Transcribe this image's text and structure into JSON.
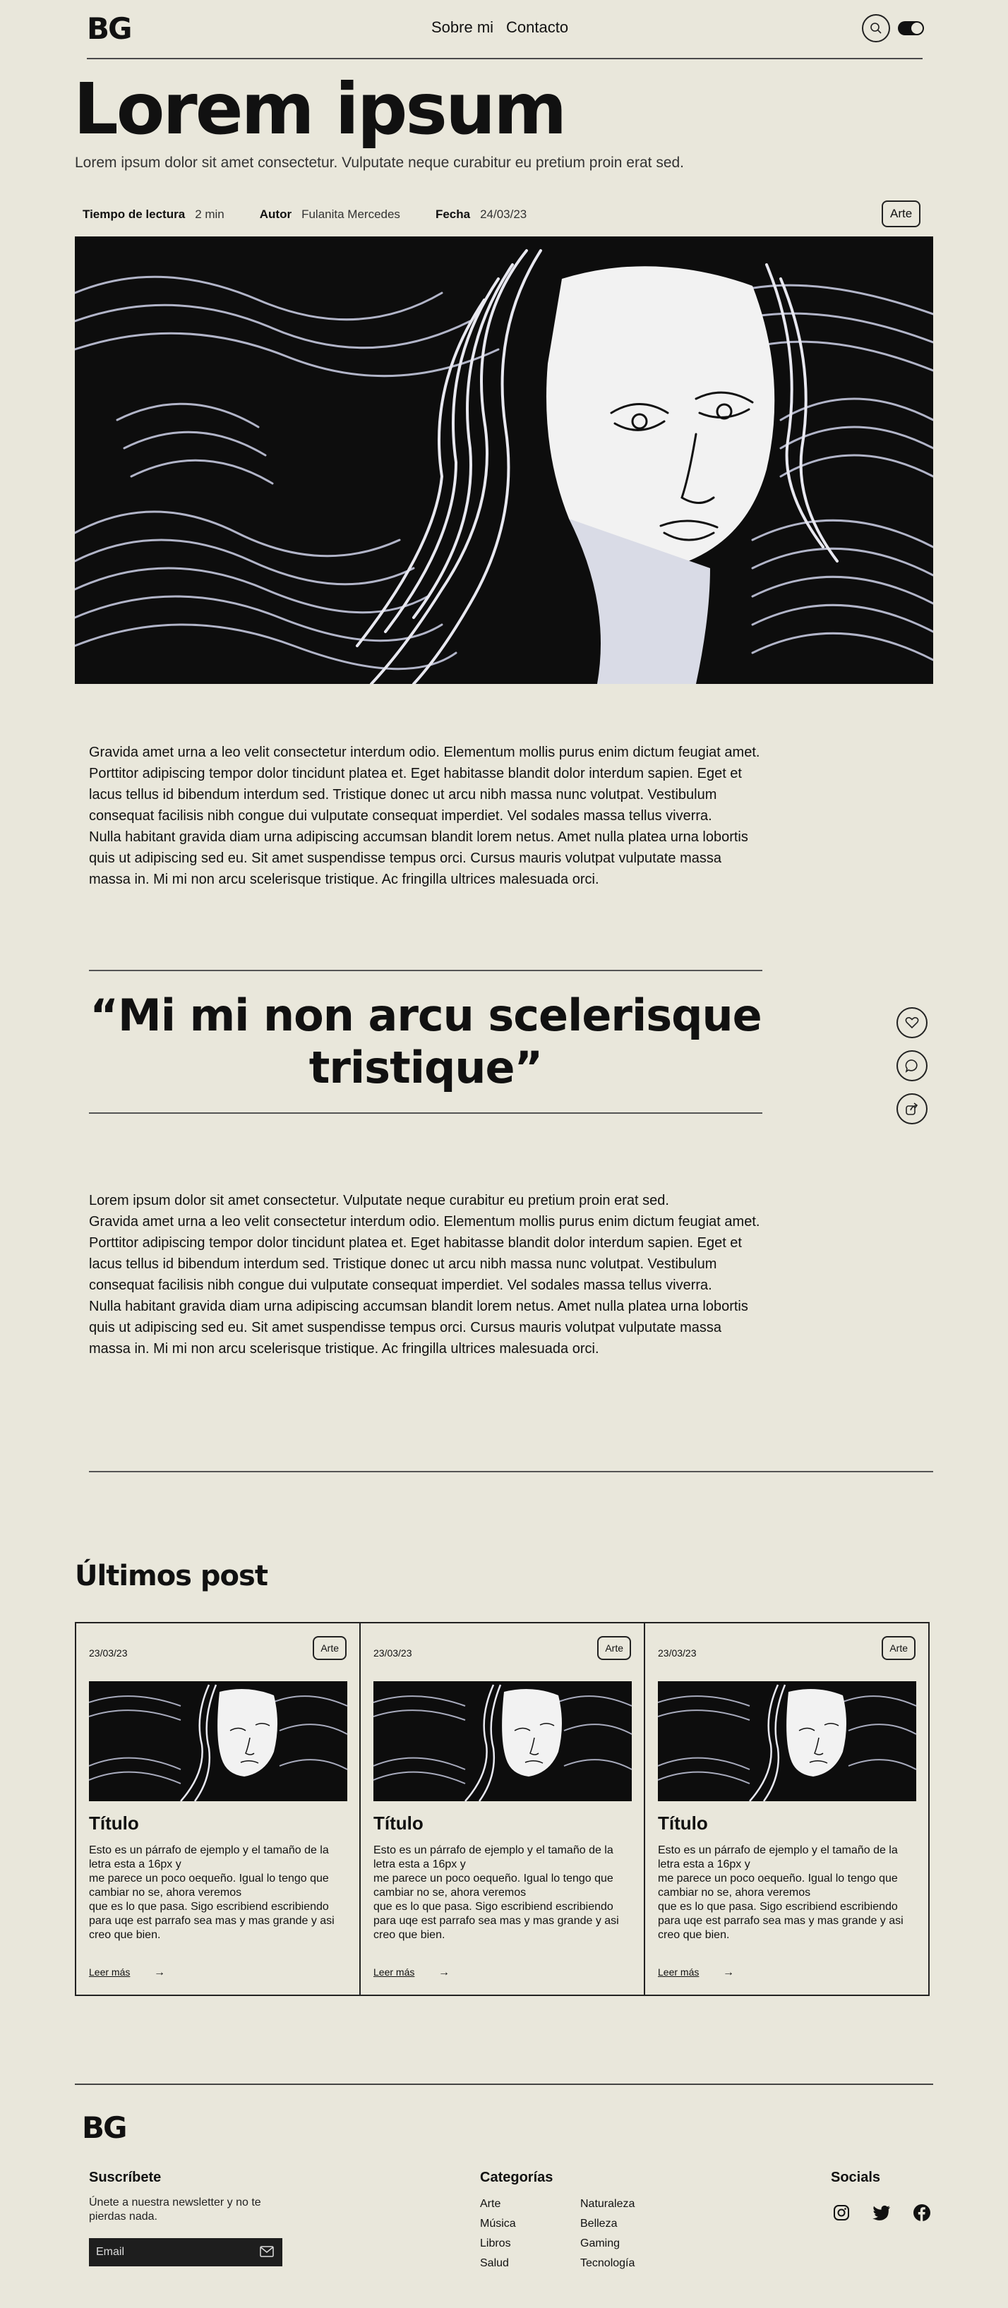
{
  "header": {
    "logo": "BG",
    "nav": [
      "Sobre mi",
      "Contacto"
    ]
  },
  "article": {
    "title": "Lorem ipsum",
    "subtitle": "Lorem ipsum dolor sit amet consectetur. Vulputate neque curabitur eu pretium proin erat sed.",
    "meta": {
      "reading_label": "Tiempo de lectura",
      "reading_value": "2 min",
      "author_label": "Autor",
      "author_value": "Fulanita Mercedes",
      "date_label": "Fecha",
      "date_value": "24/03/23"
    },
    "tag": "Arte",
    "paragraphs_1": [
      "Gravida amet urna a leo velit consectetur interdum odio. Elementum mollis purus enim dictum feugiat amet. Porttitor adipiscing tempor dolor tincidunt platea et. Eget habitasse blandit dolor interdum sapien. Eget et lacus tellus id bibendum interdum sed. Tristique donec ut arcu nibh massa nunc volutpat. Vestibulum consequat facilisis nibh congue dui vulputate consequat imperdiet. Vel sodales massa tellus viverra.",
      "Nulla habitant gravida diam urna adipiscing accumsan blandit lorem netus. Amet nulla platea urna lobortis quis ut adipiscing sed eu. Sit amet suspendisse tempus orci. Cursus mauris volutpat vulputate massa massa in. Mi mi non arcu scelerisque tristique. Ac fringilla ultrices malesuada orci."
    ],
    "quote": "“Mi mi non arcu scelerisque tristique”",
    "paragraphs_2": [
      "Lorem ipsum dolor sit amet consectetur. Vulputate neque curabitur eu pretium proin erat sed.",
      "Gravida amet urna a leo velit consectetur interdum odio. Elementum mollis purus enim dictum feugiat amet. Porttitor adipiscing tempor dolor tincidunt platea et. Eget habitasse blandit dolor interdum sapien. Eget et lacus tellus id bibendum interdum sed. Tristique donec ut arcu nibh massa nunc volutpat. Vestibulum consequat facilisis nibh congue dui vulputate consequat imperdiet. Vel sodales massa tellus viverra.",
      "Nulla habitant gravida diam urna adipiscing accumsan blandit lorem netus. Amet nulla platea urna lobortis quis ut adipiscing sed eu. Sit amet suspendisse tempus orci. Cursus mauris volutpat vulputate massa massa in. Mi mi non arcu scelerisque tristique. Ac fringilla ultrices malesuada orci."
    ],
    "actions": [
      "heart-icon",
      "comment-icon",
      "share-icon"
    ]
  },
  "latest": {
    "heading": "Últimos post",
    "cards": [
      {
        "date": "23/03/23",
        "tag": "Arte",
        "title": "Título",
        "text": "Esto es un párrafo de ejemplo y el tamaño de la letra esta a 16px y\nme parece un poco oequeño. Igual lo tengo que cambiar no se, ahora veremos\nque es lo que pasa. Sigo escribiend escribiendo para uqe est parrafo sea mas y mas grande y asi creo que bien.",
        "more": "Leer más"
      },
      {
        "date": "23/03/23",
        "tag": "Arte",
        "title": "Título",
        "text": "Esto es un párrafo de ejemplo y el tamaño de la letra esta a 16px y\nme parece un poco oequeño. Igual lo tengo que cambiar no se, ahora veremos\nque es lo que pasa. Sigo escribiend escribiendo para uqe est parrafo sea mas y mas grande y asi creo que bien.",
        "more": "Leer más"
      },
      {
        "date": "23/03/23",
        "tag": "Arte",
        "title": "Título",
        "text": "Esto es un párrafo de ejemplo y el tamaño de la letra esta a 16px y\nme parece un poco oequeño. Igual lo tengo que cambiar no se, ahora veremos\nque es lo que pasa. Sigo escribiend escribiendo para uqe est parrafo sea mas y mas grande y asi creo que bien.",
        "more": "Leer más"
      }
    ]
  },
  "footer": {
    "logo": "BG",
    "newsletter_heading": "Suscríbete",
    "newsletter_text": "Únete a nuestra newsletter y no te pierdas nada.",
    "email_placeholder": "Email",
    "categories_heading": "Categorías",
    "categories": [
      "Arte",
      "Naturaleza",
      "Música",
      "Belleza",
      "Libros",
      "Gaming",
      "Salud",
      "Tecnología"
    ],
    "socials_heading": "Socials",
    "socials": [
      "instagram-icon",
      "twitter-icon",
      "facebook-icon"
    ]
  },
  "colors": {
    "background": "#E9E7DB",
    "text": "#111111",
    "input_bg": "#1E1E1E"
  }
}
